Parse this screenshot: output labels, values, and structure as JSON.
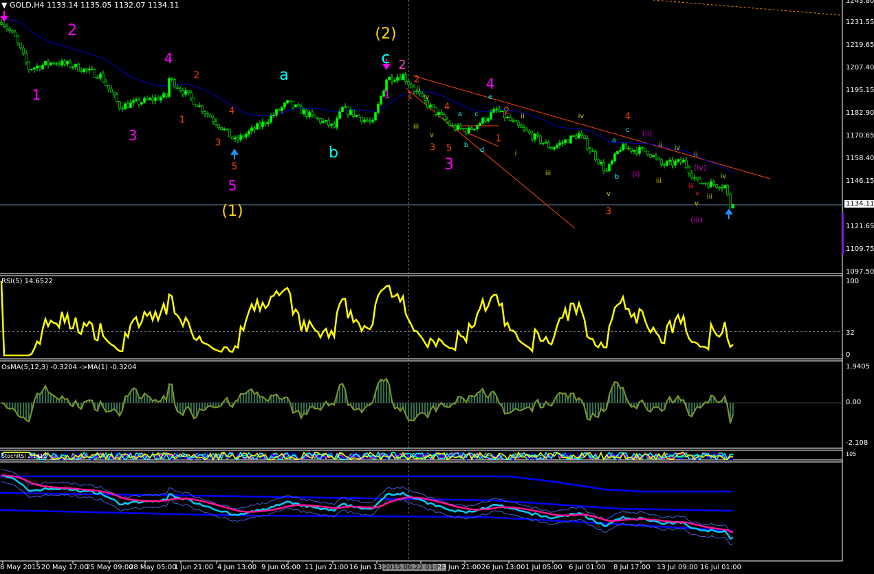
{
  "header": {
    "symbol_timeframe": "GOLD,H4",
    "ohlc": "1133.14 1135.05 1132.07 1134.11"
  },
  "price_axis": [
    "1243.80",
    "1231.55",
    "1219.65",
    "1207.40",
    "1195.15",
    "1182.90",
    "1170.65",
    "1158.40",
    "1146.15",
    "1121.65",
    "1109.75",
    "1097.50"
  ],
  "current_price": "1134.11",
  "rsi": {
    "label": "RSI(5) 14.6522",
    "axis": [
      "100",
      "32",
      "0"
    ]
  },
  "osma": {
    "label": "OsMA(5,12,3) -0.3204  ->MA(1) -0.3204",
    "axis": [
      "1.9405",
      "0.00",
      "-2.108"
    ]
  },
  "stoch": {
    "label": "StochRSI 2.1412",
    "axis": "105"
  },
  "time_axis": [
    "8 May 2015",
    "20 May 17:00",
    "25 May 09:00",
    "28 May 05:00",
    "1 Jun 21:00",
    "4 Jun 13:00",
    "9 Jun 05:00",
    "11 Jun 21:00",
    "16 Jun 13:00",
    "2015.06.22 01:00",
    "23 Jun 21:00",
    "26 Jun 13:00",
    "1 Jul 05:00",
    "6 Jul 01:00",
    "8 Jul 17:00",
    "13 Jul 09:00",
    "16 Jul 01:00"
  ],
  "colors": {
    "candle": "#00ff00",
    "ma": "#0000cc",
    "rsi": "#ffff00",
    "osma_line": "#7a9a2a",
    "osma_hist": "#2f6f4f",
    "trend": "#ff4500",
    "cyan": "#00ccff",
    "pink": "#ff1493",
    "channel": "#0000ff"
  },
  "wave_labels": [
    {
      "t": "2",
      "c": "#ff00ff"
    },
    {
      "t": "1",
      "c": "#ff00ff"
    },
    {
      "t": "3",
      "c": "#ff00ff"
    },
    {
      "t": "4",
      "c": "#ff00ff"
    },
    {
      "t": "5",
      "c": "#ff00ff"
    },
    {
      "t": "3",
      "c": "#ff00ff"
    },
    {
      "t": "4",
      "c": "#ff00ff"
    },
    {
      "t": "2",
      "c": "#ff40c0"
    },
    {
      "t": "1",
      "c": "#ff00ff"
    },
    {
      "t": "(2)",
      "c": "#ffd700"
    },
    {
      "t": "(1)",
      "c": "#ffd700"
    },
    {
      "t": "c",
      "c": "#00ffff"
    },
    {
      "t": "a",
      "c": "#00ffff"
    },
    {
      "t": "b",
      "c": "#00ffff"
    },
    {
      "t": "2",
      "c": "#ff4500"
    },
    {
      "t": "1",
      "c": "#ff4500"
    },
    {
      "t": "4",
      "c": "#ff4500"
    },
    {
      "t": "3",
      "c": "#ff4500"
    },
    {
      "t": "5",
      "c": "#ff4500"
    },
    {
      "t": "2",
      "c": "#ff4500"
    },
    {
      "t": "1",
      "c": "#ff4500"
    },
    {
      "t": "4",
      "c": "#ff4500"
    },
    {
      "t": "3",
      "c": "#ff4500"
    },
    {
      "t": "5",
      "c": "#ff4500"
    },
    {
      "t": "2",
      "c": "#ff4500"
    },
    {
      "t": "1",
      "c": "#ff4500"
    },
    {
      "t": "4",
      "c": "#ff4500"
    },
    {
      "t": "3",
      "c": "#ff4500"
    },
    {
      "t": "a",
      "c": "#00ffff"
    },
    {
      "t": "c",
      "c": "#00ffff"
    },
    {
      "t": "b",
      "c": "#00ffff"
    },
    {
      "t": "d",
      "c": "#00ffff"
    },
    {
      "t": "e",
      "c": "#00ffff"
    },
    {
      "t": "a",
      "c": "#00ffff"
    },
    {
      "t": "c",
      "c": "#00ffff"
    },
    {
      "t": "b",
      "c": "#00ffff"
    },
    {
      "t": "iii",
      "c": "#cccc00"
    },
    {
      "t": "iv",
      "c": "#cccc00"
    },
    {
      "t": "ii",
      "c": "#cccc00"
    },
    {
      "t": "v",
      "c": "#cccc00"
    },
    {
      "t": "i",
      "c": "#cccc00"
    },
    {
      "t": "ii",
      "c": "#cccc00"
    },
    {
      "t": "iii",
      "c": "#cccc00"
    },
    {
      "t": "iv",
      "c": "#cccc00"
    },
    {
      "t": "v",
      "c": "#cccc00"
    },
    {
      "t": "ii",
      "c": "#cccc00"
    },
    {
      "t": "iv",
      "c": "#cccc00"
    },
    {
      "t": "iii",
      "c": "#cccc00"
    },
    {
      "t": "ii",
      "c": "#cccc00"
    },
    {
      "t": "iii",
      "c": "#cccc00"
    },
    {
      "t": "iv",
      "c": "#cccc00"
    },
    {
      "t": "v",
      "c": "#cccc00"
    },
    {
      "t": "(ii)",
      "c": "#cc00cc"
    },
    {
      "t": "(i)",
      "c": "#cc00cc"
    },
    {
      "t": "(iv)",
      "c": "#cc00cc"
    },
    {
      "t": "(iii)",
      "c": "#cc00cc"
    },
    {
      "t": "iii",
      "c": "#ff2020"
    },
    {
      "t": "v",
      "c": "#ff2020"
    }
  ],
  "chart_data": {
    "type": "candlestick",
    "title": "GOLD,H4",
    "ylim": [
      1097.5,
      1243.8
    ],
    "close_anchors": [
      {
        "bar": 0,
        "close": 1233.4
      },
      {
        "bar": 5,
        "close": 1224
      },
      {
        "bar": 10,
        "close": 1207.4
      },
      {
        "bar": 19,
        "close": 1211
      },
      {
        "bar": 26,
        "close": 1209
      },
      {
        "bar": 36,
        "close": 1203.7
      },
      {
        "bar": 43,
        "close": 1187
      },
      {
        "bar": 60,
        "close": 1192.6
      },
      {
        "bar": 61,
        "close": 1202
      },
      {
        "bar": 68,
        "close": 1192.6
      },
      {
        "bar": 80,
        "close": 1175.8
      },
      {
        "bar": 85,
        "close": 1168.4
      },
      {
        "bar": 95,
        "close": 1177.7
      },
      {
        "bar": 104,
        "close": 1188.8
      },
      {
        "bar": 113,
        "close": 1181.4
      },
      {
        "bar": 121,
        "close": 1175.8
      },
      {
        "bar": 124,
        "close": 1185.8
      },
      {
        "bar": 135,
        "close": 1177.7
      },
      {
        "bar": 140,
        "close": 1202
      },
      {
        "bar": 146,
        "close": 1203.7
      },
      {
        "bar": 153,
        "close": 1190.7
      },
      {
        "bar": 164,
        "close": 1175.8
      },
      {
        "bar": 170,
        "close": 1174
      },
      {
        "bar": 180,
        "close": 1185
      },
      {
        "bar": 188,
        "close": 1175.8
      },
      {
        "bar": 200,
        "close": 1164.7
      },
      {
        "bar": 210,
        "close": 1172
      },
      {
        "bar": 220,
        "close": 1151.7
      },
      {
        "bar": 225,
        "close": 1164.7
      },
      {
        "bar": 235,
        "close": 1162.8
      },
      {
        "bar": 240,
        "close": 1155.4
      },
      {
        "bar": 248,
        "close": 1157.3
      },
      {
        "bar": 253,
        "close": 1146.2
      },
      {
        "bar": 263,
        "close": 1144.3
      },
      {
        "bar": 265,
        "close": 1133
      },
      {
        "bar": 266,
        "close": 1134.11
      }
    ],
    "indicators": [
      "RSI(5)",
      "OsMA(5,12,3)",
      "StochRSI"
    ]
  }
}
